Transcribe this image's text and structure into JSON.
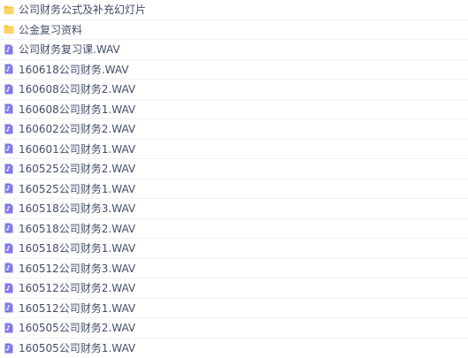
{
  "colors": {
    "folder": "#fdc43f",
    "audio": "#7e78ec",
    "text": "#424e67",
    "divider": "#f0f1f3"
  },
  "file_list": {
    "items": [
      {
        "type": "folder",
        "icon": "folder-icon",
        "name": "公司财务公式及补充幻灯片"
      },
      {
        "type": "folder",
        "icon": "folder-icon",
        "name": "公金复习资料"
      },
      {
        "type": "audio",
        "icon": "audio-file-icon",
        "name": "公司财务复习课.WAV"
      },
      {
        "type": "audio",
        "icon": "audio-file-icon",
        "name": "160618公司财务.WAV"
      },
      {
        "type": "audio",
        "icon": "audio-file-icon",
        "name": "160608公司财务2.WAV"
      },
      {
        "type": "audio",
        "icon": "audio-file-icon",
        "name": "160608公司财务1.WAV"
      },
      {
        "type": "audio",
        "icon": "audio-file-icon",
        "name": "160602公司财务2.WAV"
      },
      {
        "type": "audio",
        "icon": "audio-file-icon",
        "name": "160601公司财务1.WAV"
      },
      {
        "type": "audio",
        "icon": "audio-file-icon",
        "name": "160525公司财务2.WAV"
      },
      {
        "type": "audio",
        "icon": "audio-file-icon",
        "name": "160525公司财务1.WAV"
      },
      {
        "type": "audio",
        "icon": "audio-file-icon",
        "name": "160518公司财务3.WAV"
      },
      {
        "type": "audio",
        "icon": "audio-file-icon",
        "name": "160518公司财务2.WAV"
      },
      {
        "type": "audio",
        "icon": "audio-file-icon",
        "name": "160518公司财务1.WAV"
      },
      {
        "type": "audio",
        "icon": "audio-file-icon",
        "name": "160512公司财务3.WAV"
      },
      {
        "type": "audio",
        "icon": "audio-file-icon",
        "name": "160512公司财务2.WAV"
      },
      {
        "type": "audio",
        "icon": "audio-file-icon",
        "name": "160512公司财务1.WAV"
      },
      {
        "type": "audio",
        "icon": "audio-file-icon",
        "name": "160505公司财务2.WAV"
      },
      {
        "type": "audio",
        "icon": "audio-file-icon",
        "name": "160505公司财务1.WAV"
      }
    ]
  }
}
